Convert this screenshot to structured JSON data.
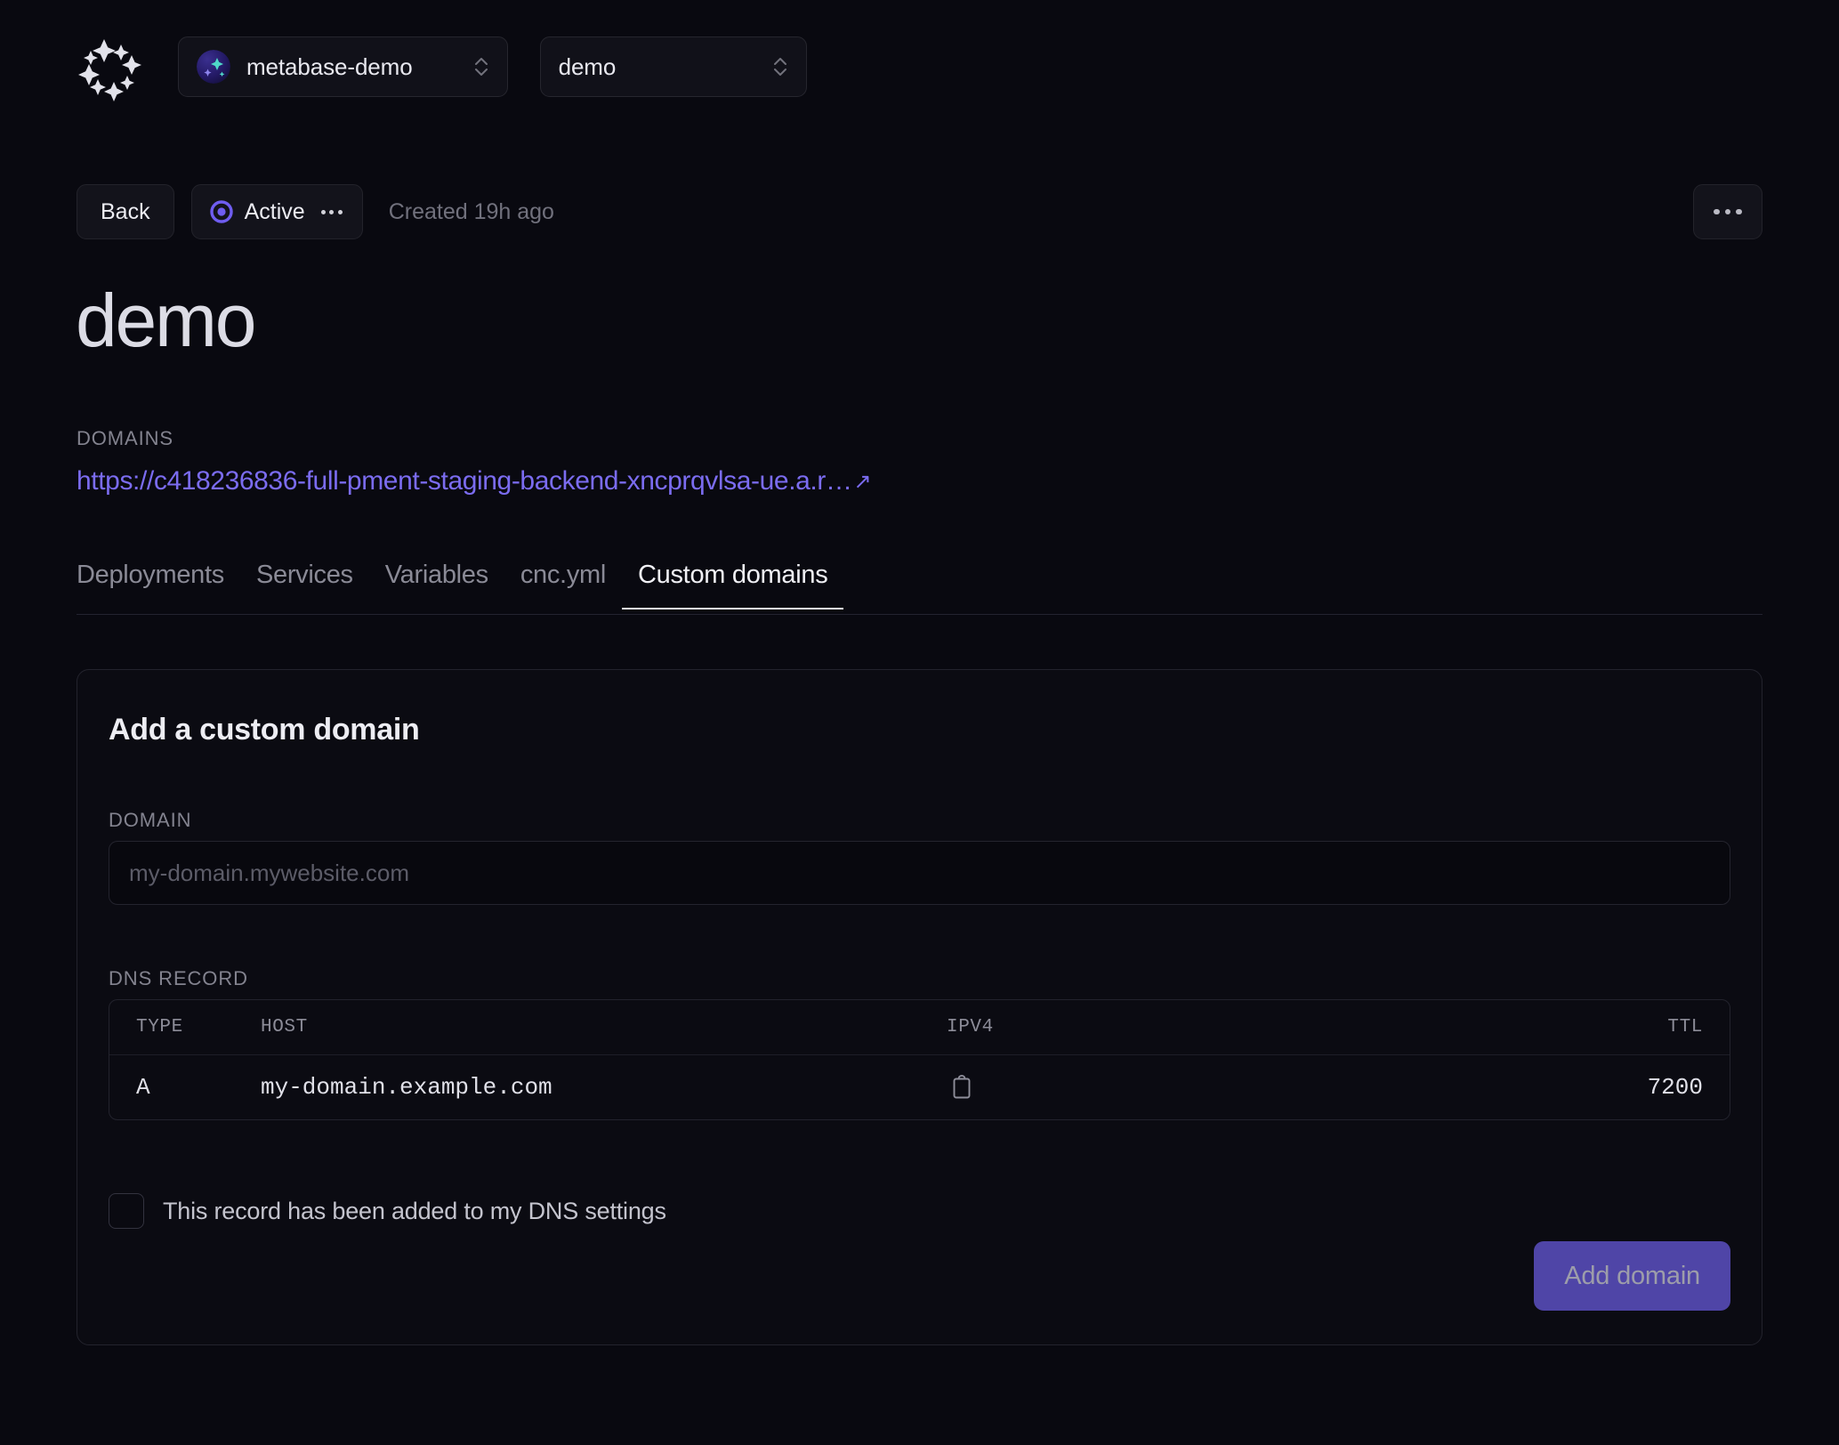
{
  "header": {
    "logo_icon": "sparkles-logo-icon",
    "org_selector": {
      "label": "metabase-demo",
      "project_icon": "project-avatar-icon",
      "chevron_icon": "chevron-up-down-icon"
    },
    "env_selector": {
      "label": "demo",
      "chevron_icon": "chevron-up-down-icon"
    }
  },
  "statusbar": {
    "back_label": "Back",
    "status_label": "Active",
    "status_icon": "active-ring-icon",
    "status_more_icon": "ellipsis-icon",
    "created_text": "Created 19h ago",
    "kebab_icon": "ellipsis-icon"
  },
  "page": {
    "title": "demo",
    "domains_label": "DOMAINS",
    "domain_url": "https://c418236836-full-pment-staging-backend-xncprqvlsa-ue.a.r…",
    "external_link_icon": "external-link-icon"
  },
  "tabs": [
    {
      "label": "Deployments",
      "active": false
    },
    {
      "label": "Services",
      "active": false
    },
    {
      "label": "Variables",
      "active": false
    },
    {
      "label": "cnc.yml",
      "active": false
    },
    {
      "label": "Custom domains",
      "active": true
    }
  ],
  "card": {
    "title": "Add a custom domain",
    "domain_field": {
      "label": "DOMAIN",
      "value": "",
      "placeholder": "my-domain.mywebsite.com"
    },
    "dns_section": {
      "label": "DNS RECORD",
      "columns": [
        "TYPE",
        "HOST",
        "IPV4",
        "TTL"
      ],
      "rows": [
        {
          "type": "A",
          "host": "my-domain.example.com",
          "ipv4": "",
          "ipv4_copy_icon": "clipboard-copy-icon",
          "ttl": "7200"
        }
      ]
    },
    "confirm_checkbox": {
      "label": "This record has been added to my DNS settings",
      "checked": false
    },
    "submit_label": "Add domain"
  },
  "colors": {
    "background": "#090910",
    "accent": "#6f5df0",
    "link": "#7b6cf0",
    "button": "#4f45a7",
    "border": "#23232d"
  }
}
